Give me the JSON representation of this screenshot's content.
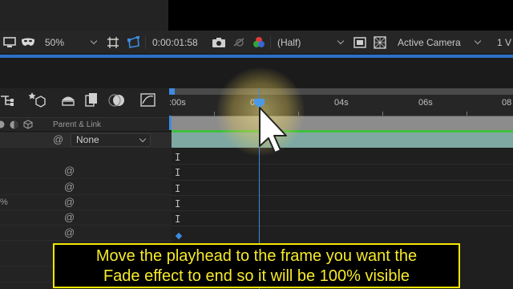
{
  "viewer_toolbar": {
    "zoom": "50%",
    "timecode": "0:00:01:58",
    "resolution": "(Half)",
    "camera": "Active Camera",
    "views": "1 V"
  },
  "layer_panel": {
    "header_parent": "Parent & Link",
    "parent_value": "None",
    "stray_char": "%"
  },
  "ruler": {
    "labels": [
      ":00s",
      "02s",
      "04s",
      "06s",
      "08"
    ]
  },
  "caption": {
    "line1": "Move the playhead to the frame you want the",
    "line2": "Fade effect to end so it will be 100% visible"
  },
  "colors": {
    "accent_blue": "#2d6fc7",
    "layer_bar": "#7fa8a2",
    "caption_text": "#f6ea2a"
  },
  "icons": [
    "monitor-icon",
    "mask-icon",
    "snapshot-icon",
    "color-channels-icon",
    "region-of-interest-icon",
    "transparency-grid-icon",
    "keyframe-icon",
    "spiral-pickwhip-icon"
  ]
}
